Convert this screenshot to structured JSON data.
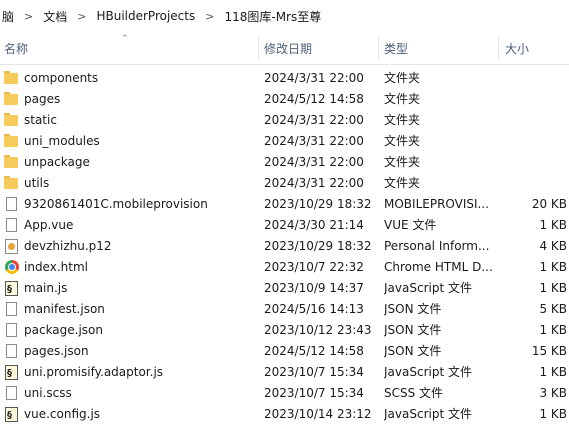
{
  "breadcrumb": [
    "脑",
    "文档",
    "HBuilderProjects",
    "118图库-Mrs至尊"
  ],
  "columns": {
    "name": "名称",
    "date": "修改日期",
    "type": "类型",
    "size": "大小"
  },
  "files": [
    {
      "name": "components",
      "date": "2024/3/31 22:00",
      "type": "文件夹",
      "size": "",
      "icon": "folder-icon"
    },
    {
      "name": "pages",
      "date": "2024/5/12 14:58",
      "type": "文件夹",
      "size": "",
      "icon": "folder-icon"
    },
    {
      "name": "static",
      "date": "2024/3/31 22:00",
      "type": "文件夹",
      "size": "",
      "icon": "folder-icon"
    },
    {
      "name": "uni_modules",
      "date": "2024/3/31 22:00",
      "type": "文件夹",
      "size": "",
      "icon": "folder-icon"
    },
    {
      "name": "unpackage",
      "date": "2024/3/31 22:00",
      "type": "文件夹",
      "size": "",
      "icon": "folder-icon"
    },
    {
      "name": "utils",
      "date": "2024/3/31 22:00",
      "type": "文件夹",
      "size": "",
      "icon": "folder-icon"
    },
    {
      "name": "9320861401C.mobileprovision",
      "date": "2023/10/29 18:32",
      "type": "MOBILEPROVISI...",
      "size": "20 KB",
      "icon": "file-icon"
    },
    {
      "name": "App.vue",
      "date": "2024/3/30 21:14",
      "type": "VUE 文件",
      "size": "1 KB",
      "icon": "file-icon"
    },
    {
      "name": "devzhizhu.p12",
      "date": "2023/10/29 18:32",
      "type": "Personal Inform...",
      "size": "4 KB",
      "icon": "certificate-icon"
    },
    {
      "name": "index.html",
      "date": "2023/10/7 22:32",
      "type": "Chrome HTML D...",
      "size": "1 KB",
      "icon": "chrome-icon"
    },
    {
      "name": "main.js",
      "date": "2023/10/9 14:37",
      "type": "JavaScript 文件",
      "size": "1 KB",
      "icon": "script-icon"
    },
    {
      "name": "manifest.json",
      "date": "2024/5/16 14:13",
      "type": "JSON 文件",
      "size": "5 KB",
      "icon": "file-icon"
    },
    {
      "name": "package.json",
      "date": "2023/10/12 23:43",
      "type": "JSON 文件",
      "size": "1 KB",
      "icon": "file-icon"
    },
    {
      "name": "pages.json",
      "date": "2024/5/12 14:58",
      "type": "JSON 文件",
      "size": "15 KB",
      "icon": "file-icon"
    },
    {
      "name": "uni.promisify.adaptor.js",
      "date": "2023/10/7 15:34",
      "type": "JavaScript 文件",
      "size": "1 KB",
      "icon": "script-icon"
    },
    {
      "name": "uni.scss",
      "date": "2023/10/7 15:34",
      "type": "SCSS 文件",
      "size": "3 KB",
      "icon": "file-icon"
    },
    {
      "name": "vue.config.js",
      "date": "2023/10/14 23:12",
      "type": "JavaScript 文件",
      "size": "1 KB",
      "icon": "script-icon"
    }
  ],
  "colors": {
    "header_text": "#4c607a",
    "folder": "#f6ca5b"
  }
}
